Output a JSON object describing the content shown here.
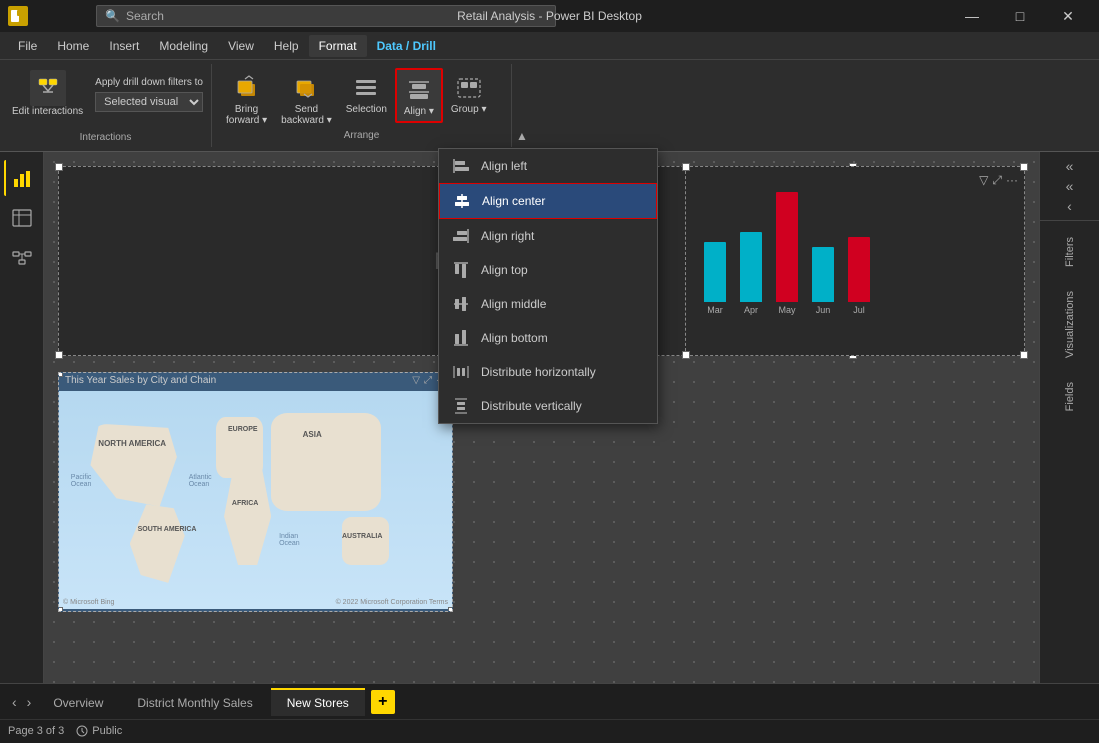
{
  "titleBar": {
    "title": "Retail Analysis - Power BI Desktop",
    "searchPlaceholder": "Search",
    "minBtn": "—",
    "maxBtn": "□",
    "closeBtn": "✕"
  },
  "menuBar": {
    "items": [
      {
        "label": "File",
        "active": false
      },
      {
        "label": "Home",
        "active": false
      },
      {
        "label": "Insert",
        "active": false
      },
      {
        "label": "Modeling",
        "active": false
      },
      {
        "label": "View",
        "active": false
      },
      {
        "label": "Help",
        "active": false
      },
      {
        "label": "Format",
        "active": true
      },
      {
        "label": "Data / Drill",
        "active": false,
        "special": true
      }
    ]
  },
  "ribbon": {
    "interactions": {
      "sectionLabel": "Interactions",
      "editLabel": "Edit\ninteractions",
      "applyLabel": "Apply drill down filters to",
      "visualSelectValue": "Selected visual",
      "editIcon": "⚡"
    },
    "arrange": {
      "sectionLabel": "Arrange",
      "buttons": [
        {
          "label": "Bring\nforward",
          "icon": "⬆",
          "hasDropdown": true
        },
        {
          "label": "Send\nbackward",
          "icon": "⬇",
          "hasDropdown": true
        },
        {
          "label": "Selection",
          "icon": "☰",
          "hasDropdown": false
        },
        {
          "label": "Align",
          "icon": "⊟",
          "hasDropdown": true,
          "highlighted": true
        },
        {
          "label": "Group",
          "icon": "⊞",
          "hasDropdown": true
        }
      ]
    }
  },
  "alignDropdown": {
    "items": [
      {
        "label": "Align left",
        "icon": "align-left"
      },
      {
        "label": "Align center",
        "icon": "align-center",
        "highlighted": true
      },
      {
        "label": "Align right",
        "icon": "align-right"
      },
      {
        "label": "Align top",
        "icon": "align-top"
      },
      {
        "label": "Align middle",
        "icon": "align-middle"
      },
      {
        "label": "Align bottom",
        "icon": "align-bottom"
      },
      {
        "label": "Distribute horizontally",
        "icon": "distribute-h"
      },
      {
        "label": "Distribute vertically",
        "icon": "distribute-v"
      }
    ]
  },
  "rightPanel": {
    "collapseArrows": [
      "«",
      "«",
      "‹"
    ],
    "tabs": [
      "Filters",
      "Visualizations",
      "Fields"
    ]
  },
  "tabBar": {
    "navBtns": [
      "‹",
      "›"
    ],
    "tabs": [
      {
        "label": "Overview",
        "active": false
      },
      {
        "label": "District Monthly Sales",
        "active": false
      },
      {
        "label": "New Stores",
        "active": true
      }
    ],
    "addBtn": "+"
  },
  "statusBar": {
    "page": "Page 3 of 3",
    "visibility": "Public"
  },
  "barChart": {
    "months": [
      "Mar",
      "Apr",
      "May",
      "Jun",
      "Jul"
    ],
    "bars": [
      {
        "color": "#00b0c8",
        "height": 60
      },
      {
        "color": "#00b0c8",
        "height": 70
      },
      {
        "color": "#d00020",
        "height": 110
      },
      {
        "color": "#00b0c8",
        "height": 55
      },
      {
        "color": "#d00020",
        "height": 65
      }
    ]
  }
}
